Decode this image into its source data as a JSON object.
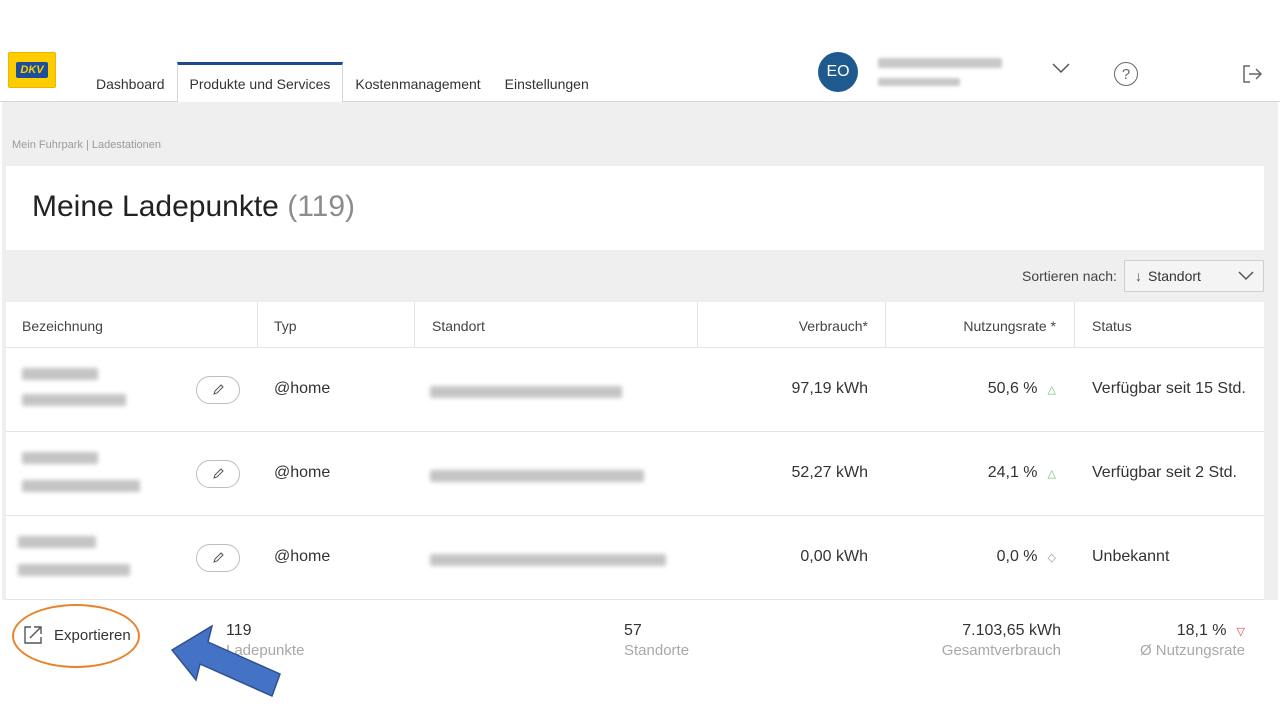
{
  "header": {
    "logo_text": "DKV",
    "tabs": [
      "Dashboard",
      "Produkte und Services",
      "Kostenmanagement",
      "Einstellungen"
    ],
    "active_tab": "Produkte und Services",
    "avatar_initials": "EO",
    "help_icon": "question-circle-icon",
    "logout_icon": "logout-icon"
  },
  "breadcrumb": "Mein Fuhrpark |  Ladestationen",
  "page": {
    "title": "Meine Ladepunkte",
    "count": "(119)"
  },
  "sort": {
    "label": "Sortieren nach:",
    "value": "Standort"
  },
  "table": {
    "headers": [
      "Bezeichnung",
      "Typ",
      "Standort",
      "Verbrauch*",
      "Nutzungsrate *",
      "Status"
    ],
    "rows": [
      {
        "typ": "@home",
        "verbrauch": "97,19 kWh",
        "rate": "50,6 %",
        "trend": "up",
        "status": "Verfügbar seit 15 Std."
      },
      {
        "typ": "@home",
        "verbrauch": "52,27 kWh",
        "rate": "24,1 %",
        "trend": "up",
        "status": "Verfügbar seit 2 Std."
      },
      {
        "typ": "@home",
        "verbrauch": "0,00 kWh",
        "rate": "0,0 %",
        "trend": "neutral",
        "status": "Unbekannt"
      }
    ]
  },
  "footer": {
    "export_label": "Exportieren",
    "stats": [
      {
        "value": "119",
        "label": "Ladepunkte"
      },
      {
        "value": "57",
        "label": "Standorte"
      },
      {
        "value": "7.103,65 kWh",
        "label": "Gesamtverbrauch"
      },
      {
        "value": "18,1 %",
        "label": "Ø Nutzungsrate"
      }
    ]
  },
  "colors": {
    "brand_blue": "#1d4a8c",
    "avatar": "#1e5a8e",
    "trend_up": "#6cc06c",
    "trend_down": "#e04040",
    "annotation_circle": "#e8832a",
    "annotation_arrow": "#4472c4"
  }
}
